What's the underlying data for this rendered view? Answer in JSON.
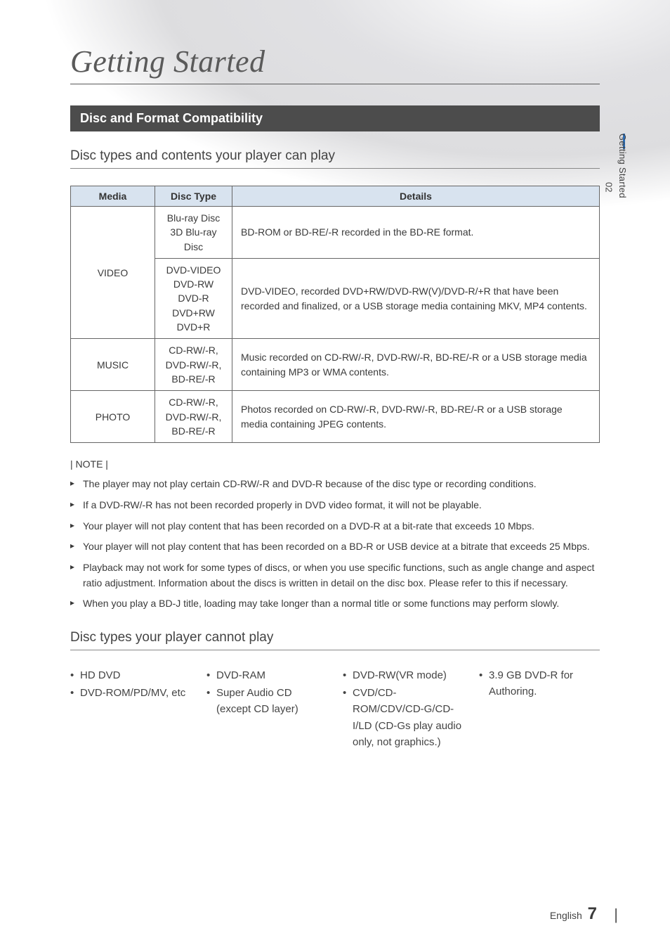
{
  "sideTab": {
    "num": "02",
    "label": "Getting Started"
  },
  "chapterTitle": "Getting Started",
  "sectionBar": "Disc and Format Compatibility",
  "sub1": "Disc types and contents your player can play",
  "tableHeaders": {
    "media": "Media",
    "discType": "Disc Type",
    "details": "Details"
  },
  "rows": {
    "videoMedia": "VIDEO",
    "video1DiscType": "Blu-ray Disc\n3D Blu-ray Disc",
    "video1Details": "BD-ROM or BD-RE/-R recorded in the BD-RE format.",
    "video2DiscType": "DVD-VIDEO\nDVD-RW\nDVD-R\nDVD+RW\nDVD+R",
    "video2Details": "DVD-VIDEO, recorded DVD+RW/DVD-RW(V)/DVD-R/+R that have been recorded and finalized, or a USB storage media containing MKV, MP4 contents.",
    "musicMedia": "MUSIC",
    "musicDiscType": "CD-RW/-R,\nDVD-RW/-R,\nBD-RE/-R",
    "musicDetails": "Music recorded on CD-RW/-R, DVD-RW/-R, BD-RE/-R or a USB storage media containing MP3 or WMA contents.",
    "photoMedia": "PHOTO",
    "photoDiscType": "CD-RW/-R,\nDVD-RW/-R,\nBD-RE/-R",
    "photoDetails": "Photos recorded on CD-RW/-R, DVD-RW/-R, BD-RE/-R or a USB storage media containing JPEG contents."
  },
  "noteHead": "| NOTE |",
  "notes": [
    "The player may not play certain CD-RW/-R and DVD-R because of the disc type or recording conditions.",
    "If a DVD-RW/-R has not been recorded properly in DVD video format, it will not be playable.",
    "Your player will not play content that has been recorded on a DVD-R at a bit-rate that exceeds 10 Mbps.",
    "Your player will not play content that has been recorded on a BD-R or USB device at a bitrate that exceeds 25 Mbps.",
    "Playback may not work for some types of discs, or when you use specific functions, such as angle change and aspect ratio adjustment. Information about the discs is written in detail on the disc box. Please refer to this if necessary.",
    "When you play a BD-J title, loading may take longer than a normal title or some functions may perform slowly."
  ],
  "sub2": "Disc types your player cannot play",
  "cannot": {
    "c1a": "HD DVD",
    "c1b": "DVD-ROM/PD/MV, etc",
    "c2a": "DVD-RAM",
    "c2b": "Super Audio CD (except CD layer)",
    "c3a": "DVD-RW(VR mode)",
    "c3b": "CVD/CD-ROM/CDV/CD-G/CD-I/LD (CD-Gs play audio only, not graphics.)",
    "c4a": "3.9 GB DVD-R for Authoring."
  },
  "footer": {
    "lang": "English",
    "pageNum": "7"
  }
}
